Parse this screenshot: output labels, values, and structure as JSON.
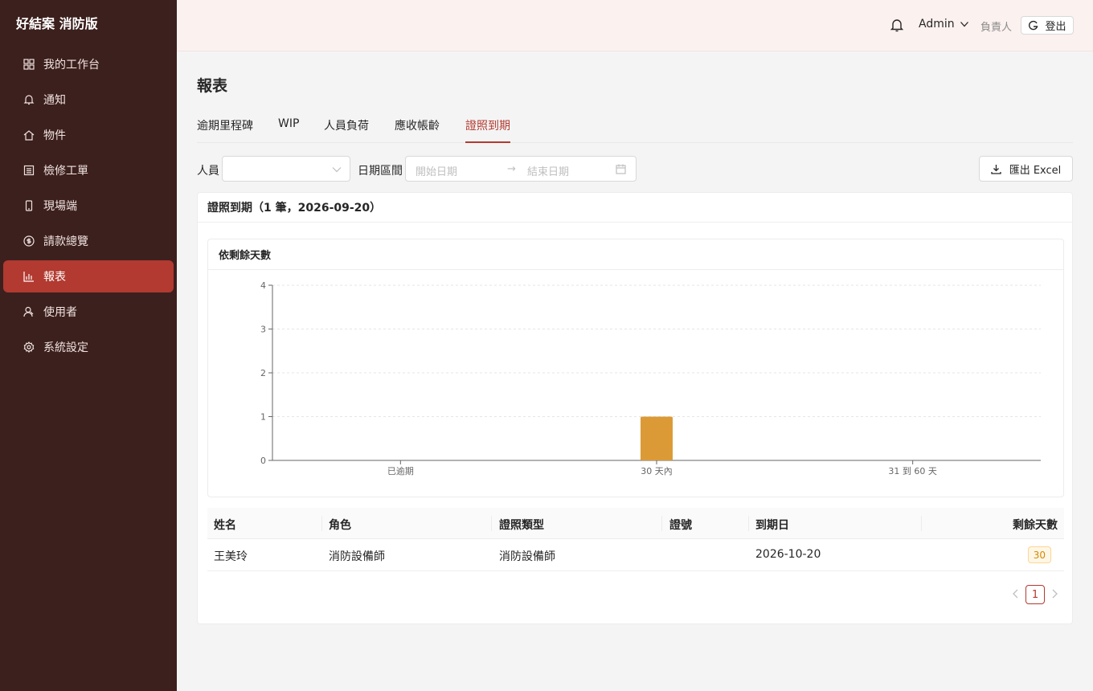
{
  "app": {
    "brand": "好結案 消防版"
  },
  "sidebar": {
    "items": [
      {
        "label": "我的工作台",
        "icon": "grid-icon"
      },
      {
        "label": "通知",
        "icon": "bell-icon"
      },
      {
        "label": "物件",
        "icon": "home-icon"
      },
      {
        "label": "檢修工單",
        "icon": "list-icon"
      },
      {
        "label": "現場端",
        "icon": "mobile-icon"
      },
      {
        "label": "請款總覽",
        "icon": "dollar-icon"
      },
      {
        "label": "報表",
        "icon": "bar-chart-icon",
        "active": true
      },
      {
        "label": "使用者",
        "icon": "user-icon"
      },
      {
        "label": "系統設定",
        "icon": "gear-icon"
      }
    ]
  },
  "header": {
    "user": "Admin",
    "role": "負責人",
    "logout_label": "登出"
  },
  "page": {
    "title": "報表"
  },
  "tabs": [
    {
      "label": "逾期里程碑"
    },
    {
      "label": "WIP"
    },
    {
      "label": "人員負荷"
    },
    {
      "label": "應收帳齡"
    },
    {
      "label": "證照到期",
      "active": true
    }
  ],
  "filters": {
    "person_label": "人員",
    "date_label": "日期區間",
    "start_placeholder": "開始日期",
    "end_placeholder": "結束日期",
    "export_label": "匯出 Excel"
  },
  "card": {
    "title": "證照到期（1 筆，2026-09-20）",
    "chart_title": "依剩餘天數"
  },
  "chart_data": {
    "type": "bar",
    "title": "依剩餘天數",
    "categories": [
      "已逾期",
      "30 天內",
      "31 到 60 天"
    ],
    "values": [
      0,
      1,
      0
    ],
    "ylim": [
      0,
      4
    ],
    "yticks": [
      0,
      1,
      2,
      3,
      4
    ],
    "grid": true,
    "bar_color": "#dc9a36"
  },
  "table": {
    "columns": [
      "姓名",
      "角色",
      "證照類型",
      "證號",
      "到期日",
      "剩餘天數"
    ],
    "rows": [
      {
        "name": "王美玲",
        "role": "消防設備師",
        "cert_type": "消防設備師",
        "cert_no": "",
        "expiry": "2026-10-20",
        "days_left": "30"
      }
    ]
  },
  "pagination": {
    "current": "1"
  },
  "colors": {
    "accent": "#b23a30",
    "sidebar_bg": "#3c201d",
    "header_bg": "#fbf1ef"
  }
}
